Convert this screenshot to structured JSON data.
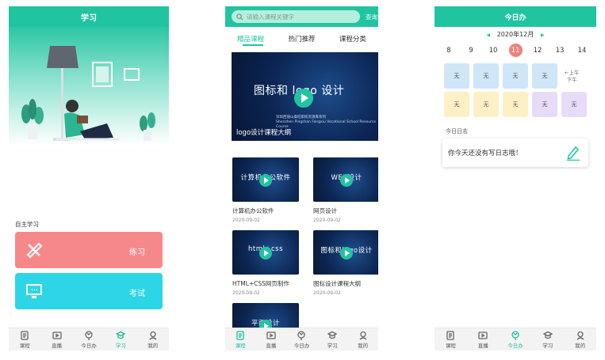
{
  "tabbar": {
    "items": [
      {
        "label": "课程",
        "icon": "course-icon"
      },
      {
        "label": "直播",
        "icon": "live-icon"
      },
      {
        "label": "今日办",
        "icon": "today-icon"
      },
      {
        "label": "学习",
        "icon": "study-icon"
      },
      {
        "label": "我的",
        "icon": "profile-icon"
      }
    ]
  },
  "study": {
    "title": "学习",
    "section_label": "自主学习",
    "practice_label": "练习",
    "exam_label": "考试",
    "active_tab": "学习"
  },
  "courses": {
    "search_placeholder": "请输入课程关键字",
    "search_button": "查询",
    "tabs": [
      "精品课程",
      "热门推荐",
      "课程分类"
    ],
    "active_tab": "精品课程",
    "banner": {
      "title": "图标和 logo 设计",
      "subtitle_line1": "深圳西丽山桑旺职校资源库系列",
      "subtitle_line2": "Shenzhen Pingshan Fangxiu Vocational School Resource Course",
      "caption": "logo设计课程大纲"
    },
    "cards": [
      {
        "thumb_text": "计算机办公软件",
        "title": "计算机办公软件",
        "date": "2020-09-02"
      },
      {
        "thumb_text": "WEB设计",
        "title": "网页设计",
        "date": "2020-09-02"
      },
      {
        "thumb_text": "html+css",
        "title": "HTML+CSS网页制作",
        "date": "2020-09-02"
      },
      {
        "thumb_text": "图标和logo设计",
        "title": "图标设计课程大纲",
        "date": "2020-09-02"
      },
      {
        "thumb_text": "平面设计",
        "title": "",
        "date": ""
      }
    ],
    "active_tab_bar": "课程"
  },
  "today": {
    "title": "今日办",
    "month": "2020年12月",
    "prev_arrow": "◀",
    "next_arrow": "▶",
    "days": [
      "8",
      "9",
      "10",
      "11",
      "12",
      "13",
      "14"
    ],
    "today_day": "11",
    "am_row": [
      "无",
      "无",
      "无",
      "无"
    ],
    "pm_row": [
      "无",
      "无",
      "无",
      "无",
      "无"
    ],
    "noon_top": "←上午",
    "noon_bottom": "下午",
    "diary_label": "今日日志",
    "diary_text": "你今天还没有写日志哦！",
    "active_tab_bar": "今日办",
    "colors": {
      "accent": "#21c4a0",
      "today": "#f0807a"
    }
  }
}
